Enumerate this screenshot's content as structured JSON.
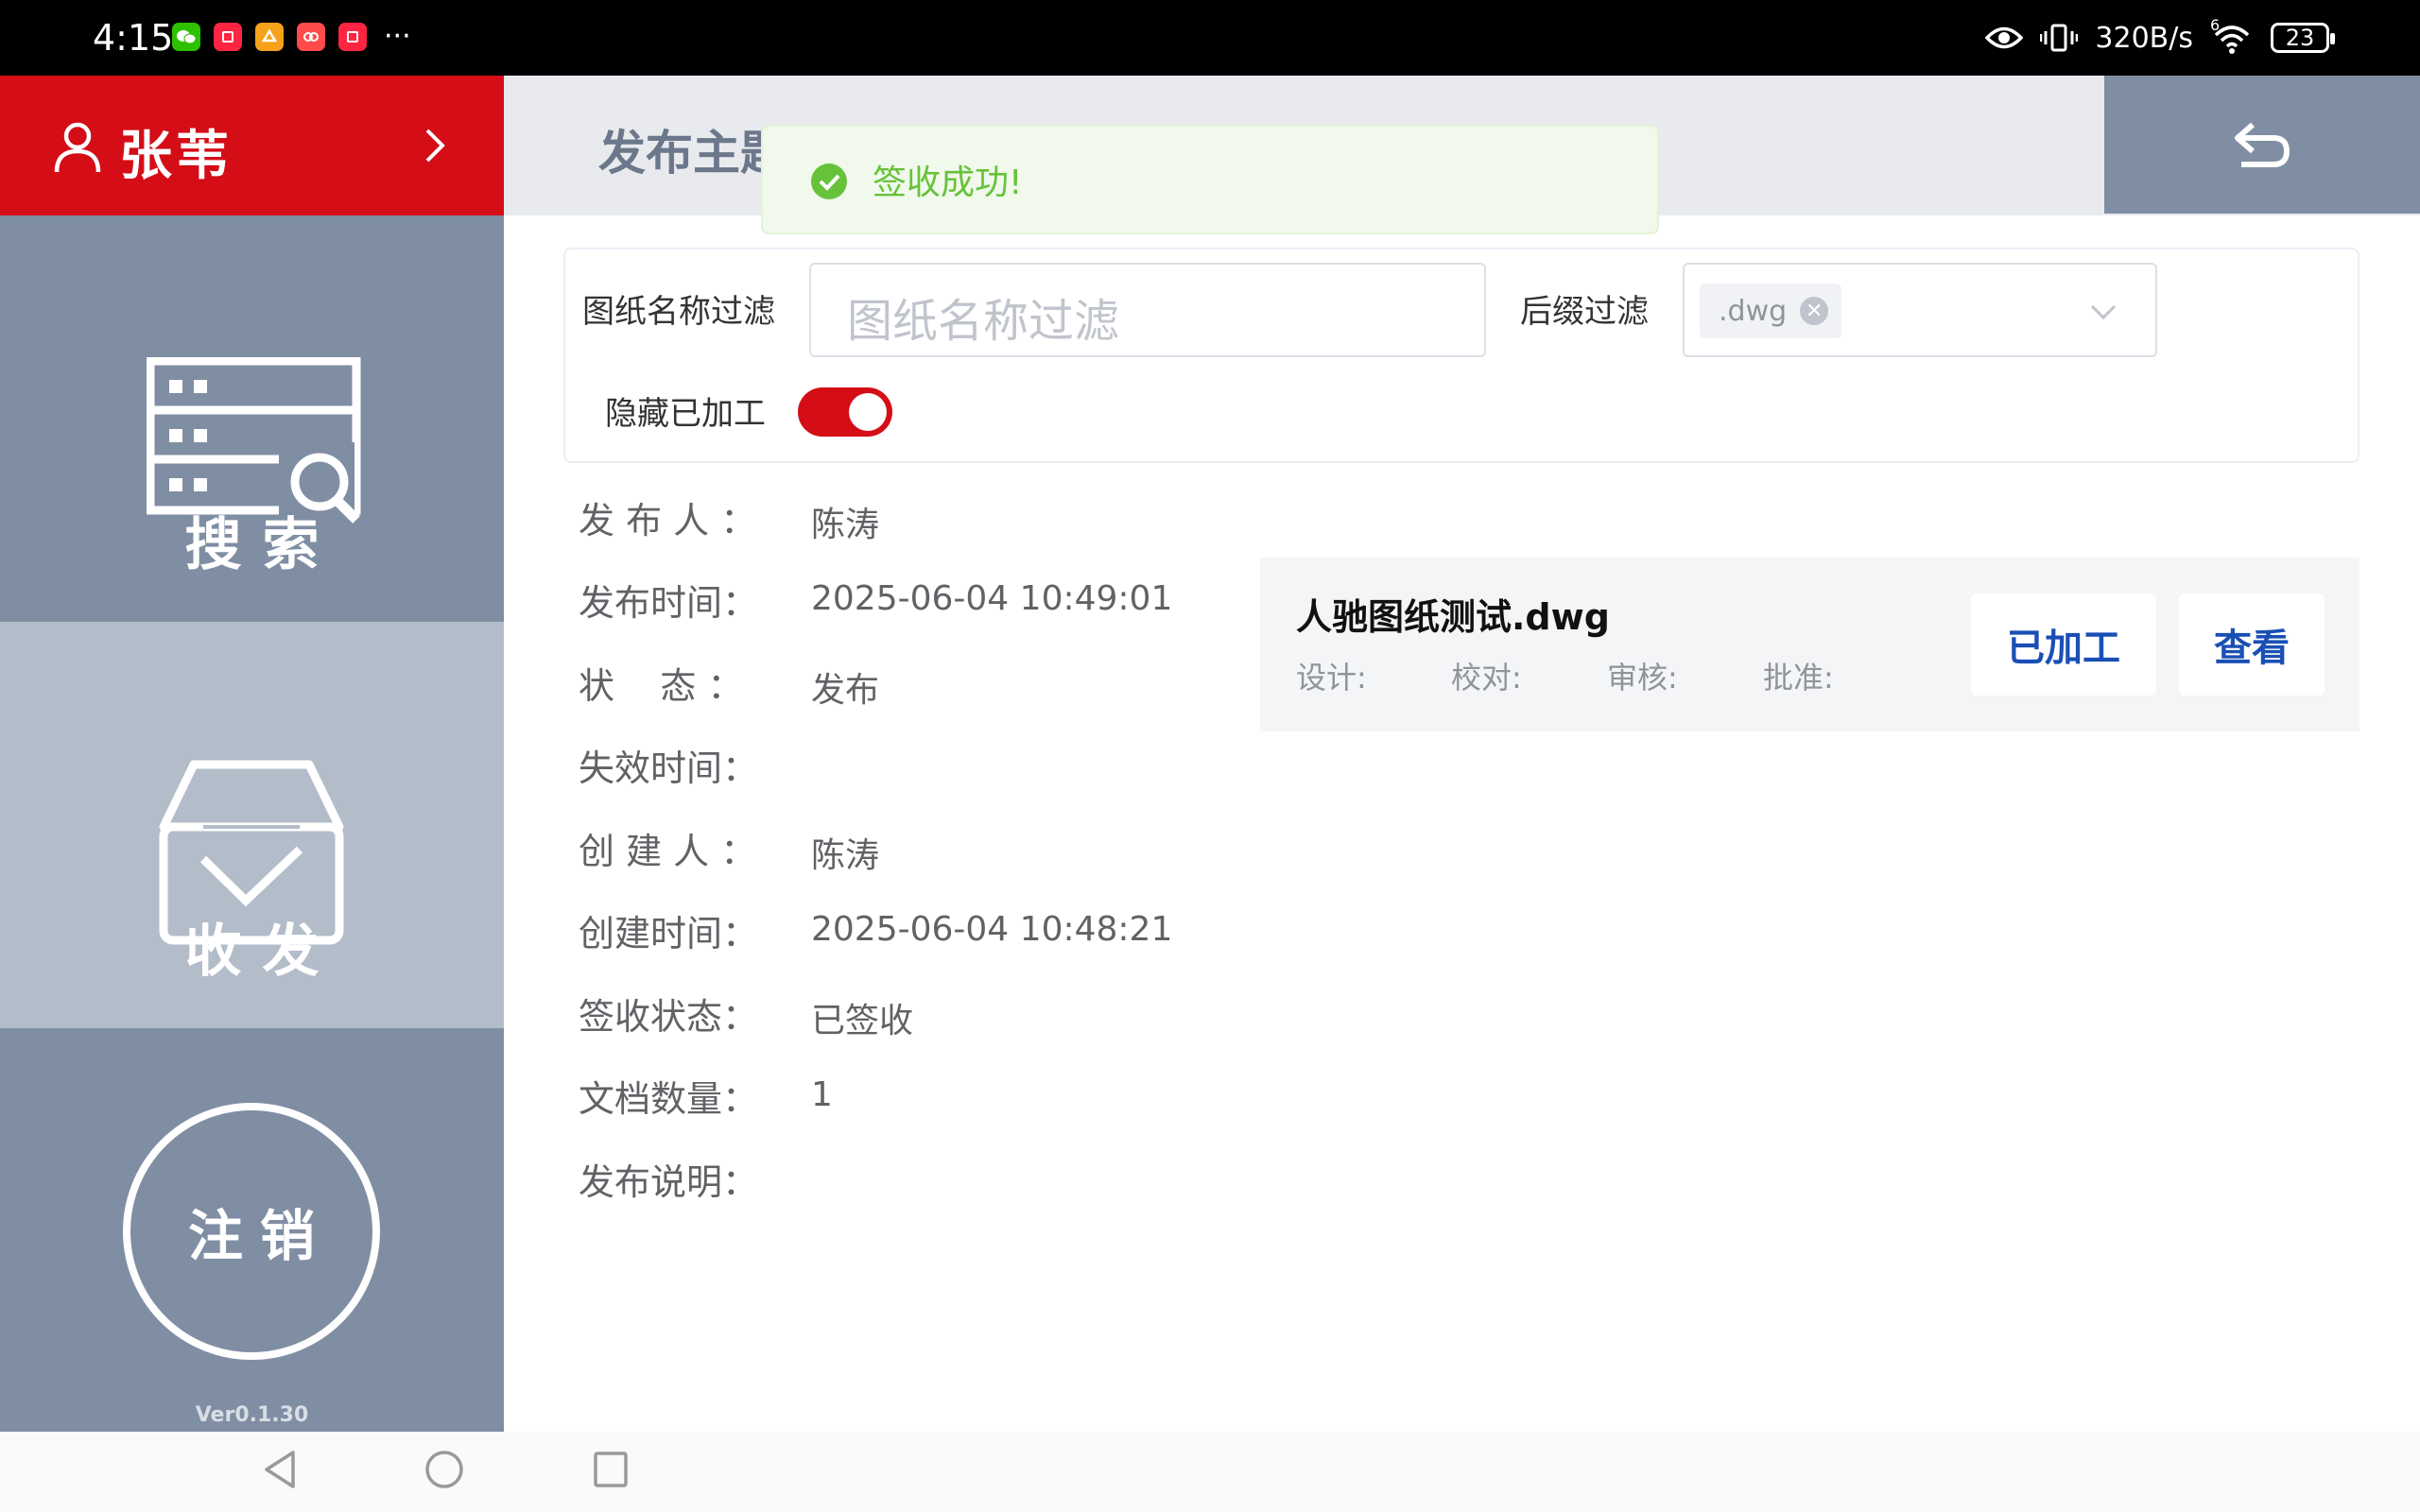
{
  "status_bar": {
    "time": "4:15",
    "more": "···",
    "net_speed": "320B/s",
    "signal": "6",
    "battery": "23",
    "apps": [
      {
        "icon": "wechat-icon",
        "color": "#2dc100"
      },
      {
        "icon": "rednote-icon",
        "color": "#ff2442"
      },
      {
        "icon": "app-orange-icon",
        "color": "#f6a21a"
      },
      {
        "icon": "app-red-icon",
        "color": "#ff4b4b"
      },
      {
        "icon": "rednote-icon",
        "color": "#ff2442"
      }
    ]
  },
  "sidebar": {
    "user_name": "张苇",
    "search_label": "搜索",
    "inbox_label": "收发",
    "logout_label": "注销",
    "version": "Ver0.1.30"
  },
  "header": {
    "title": "发布主题"
  },
  "toast": {
    "message": "签收成功!"
  },
  "filter": {
    "name_label": "图纸名称过滤",
    "name_placeholder": "图纸名称过滤",
    "suffix_label": "后缀过滤",
    "suffix_tag": ".dwg",
    "hide_processed_label": "隐藏已加工",
    "hide_processed_on": true
  },
  "info": {
    "rows": [
      {
        "key": "发 布 人 ：",
        "value": "陈涛"
      },
      {
        "key": "发布时间：",
        "value": "2025-06-04 10:49:01"
      },
      {
        "key": "状    态 ：",
        "value": "发布"
      },
      {
        "key": "失效时间：",
        "value": ""
      },
      {
        "key": "创 建 人 ：",
        "value": "陈涛"
      },
      {
        "key": "创建时间：",
        "value": "2025-06-04 10:48:21"
      },
      {
        "key": "签收状态：",
        "value": "已签收"
      },
      {
        "key": "文档数量：",
        "value": "1"
      },
      {
        "key": "发布说明：",
        "value": ""
      }
    ]
  },
  "document": {
    "name": "人驰图纸测试.dwg",
    "design_label": "设计:",
    "check_label": "校对:",
    "review_label": "审核:",
    "approve_label": "批准:",
    "processed_button": "已加工",
    "view_button": "查看"
  },
  "colors": {
    "brand_red": "#d40d17",
    "sidebar": "#7f8ea3",
    "sidebar_active": "#b3bcc9",
    "success": "#67c23a",
    "link_blue": "#1a4fb5"
  }
}
